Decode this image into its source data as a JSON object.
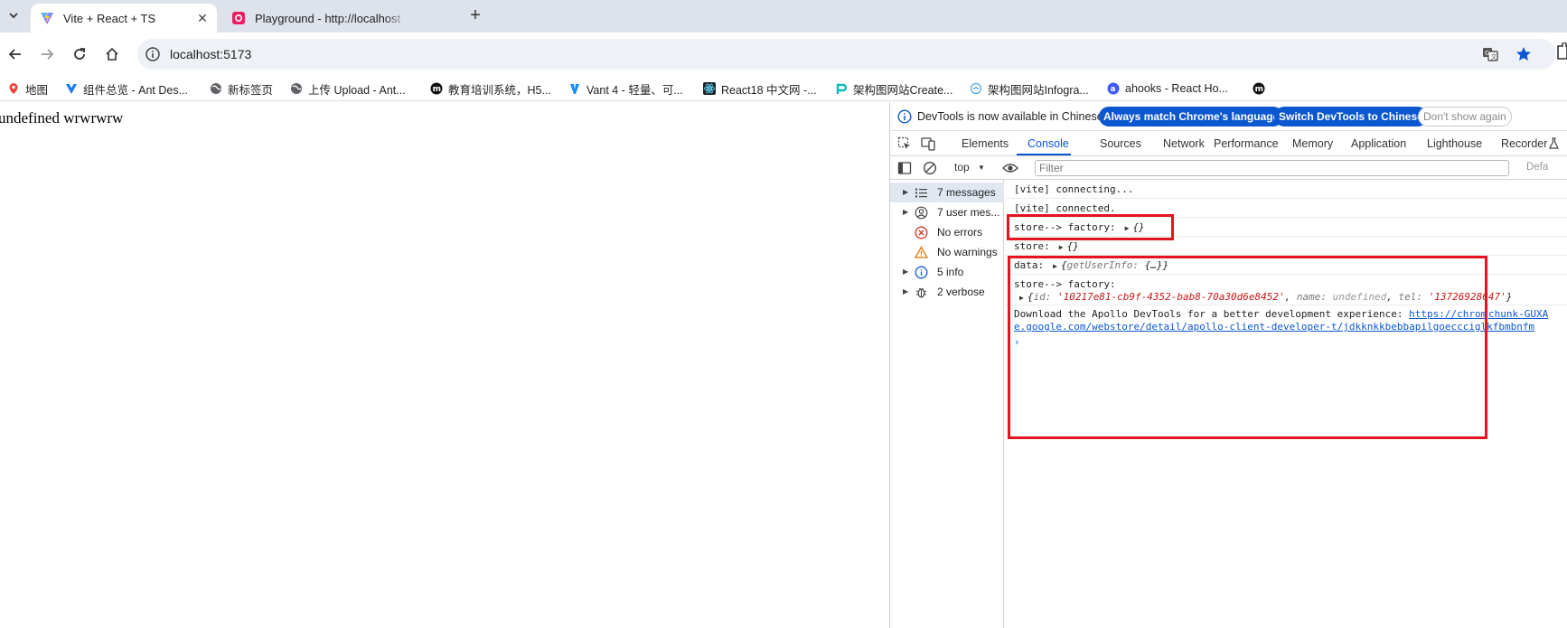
{
  "tabs": [
    {
      "title": "Vite + React + TS",
      "active": true,
      "close": "✕"
    },
    {
      "title": "Playground - http://localhost",
      "active": false
    }
  ],
  "new_tab_label": "+",
  "toolbar": {
    "url": "localhost:5173"
  },
  "bookmarks": [
    {
      "label": "地图",
      "icon": "maps-icon"
    },
    {
      "label": "组件总览 - Ant Des...",
      "icon": "vue-icon"
    },
    {
      "label": "新标签页",
      "icon": "globe-icon"
    },
    {
      "label": "上传 Upload - Ant...",
      "icon": "globe-icon"
    },
    {
      "label": "教育培训系统，H5...",
      "icon": "m-icon"
    },
    {
      "label": "Vant 4 - 轻量、可...",
      "icon": "vant-icon"
    },
    {
      "label": "React18 中文网 -...",
      "icon": "react-icon"
    },
    {
      "label": "架构图网站Create...",
      "icon": "p-icon"
    },
    {
      "label": "架构图网站Infogra...",
      "icon": "cloud-icon"
    },
    {
      "label": "ahooks - React Ho...",
      "icon": "a-icon"
    },
    {
      "label": "",
      "icon": "m-icon"
    }
  ],
  "page": {
    "text": "undefined wrwrwrw"
  },
  "devtools": {
    "infobar": {
      "message": "DevTools is now available in Chinese!",
      "btn_match": "Always match Chrome's language",
      "btn_switch": "Switch DevTools to Chinese",
      "btn_dismiss": "Don't show again"
    },
    "tabs": [
      "Elements",
      "Console",
      "Sources",
      "Network",
      "Performance",
      "Memory",
      "Application",
      "Lighthouse",
      "Recorder"
    ],
    "active_tab": "Console",
    "console_toolbar": {
      "context": "top",
      "filter_placeholder": "Filter",
      "levels": "Defa"
    },
    "sidebar": [
      {
        "label": "7 messages",
        "icon": "list-icon",
        "expandable": true,
        "selected": true
      },
      {
        "label": "7 user mes...",
        "icon": "user-icon",
        "expandable": true,
        "selected": false
      },
      {
        "label": "No errors",
        "icon": "error-icon",
        "expandable": false,
        "selected": false
      },
      {
        "label": "No warnings",
        "icon": "warning-icon",
        "expandable": false,
        "selected": false
      },
      {
        "label": "5 info",
        "icon": "info-icon",
        "expandable": true,
        "selected": false
      },
      {
        "label": "2 verbose",
        "icon": "bug-icon",
        "expandable": true,
        "selected": false
      }
    ],
    "console": {
      "l1": "[vite] connecting...",
      "l2": "[vite] connected.",
      "l3_prefix": "store--> factory:",
      "l3_obj": "{}",
      "l4_prefix": "store:",
      "l4_obj": "{}",
      "l5_prefix": "data:",
      "l5_obj_open": "{",
      "l5_key": "getUserInfo:",
      "l5_val": " {…}",
      "l5_obj_close": "}",
      "l6_prefix": "store--> factory:",
      "l6_open": "{",
      "l6_id_key": "id:",
      "l6_id_val": "'10217e81-cb9f-4352-bab8-70a30d6e8452'",
      "l6_name_key": "name:",
      "l6_name_val": "undefined",
      "l6_tel_key": "tel:",
      "l6_tel_val": "'13726928647'",
      "l6_close": "}",
      "l7_text": "Download the Apollo DevTools for a better development experience:",
      "l7_link1": "https://chrom",
      "l7_source": "chunk-GUXA",
      "l7_link2": "e.google.com/webstore/detail/apollo-client-developer-t/jdkknkkbebbapilgoeccciglkfbmbnfm",
      "prompt": "›"
    }
  },
  "colors": {
    "highlight_box": "#e3141f",
    "accent": "#0b57d0",
    "string": "#c41a16"
  }
}
